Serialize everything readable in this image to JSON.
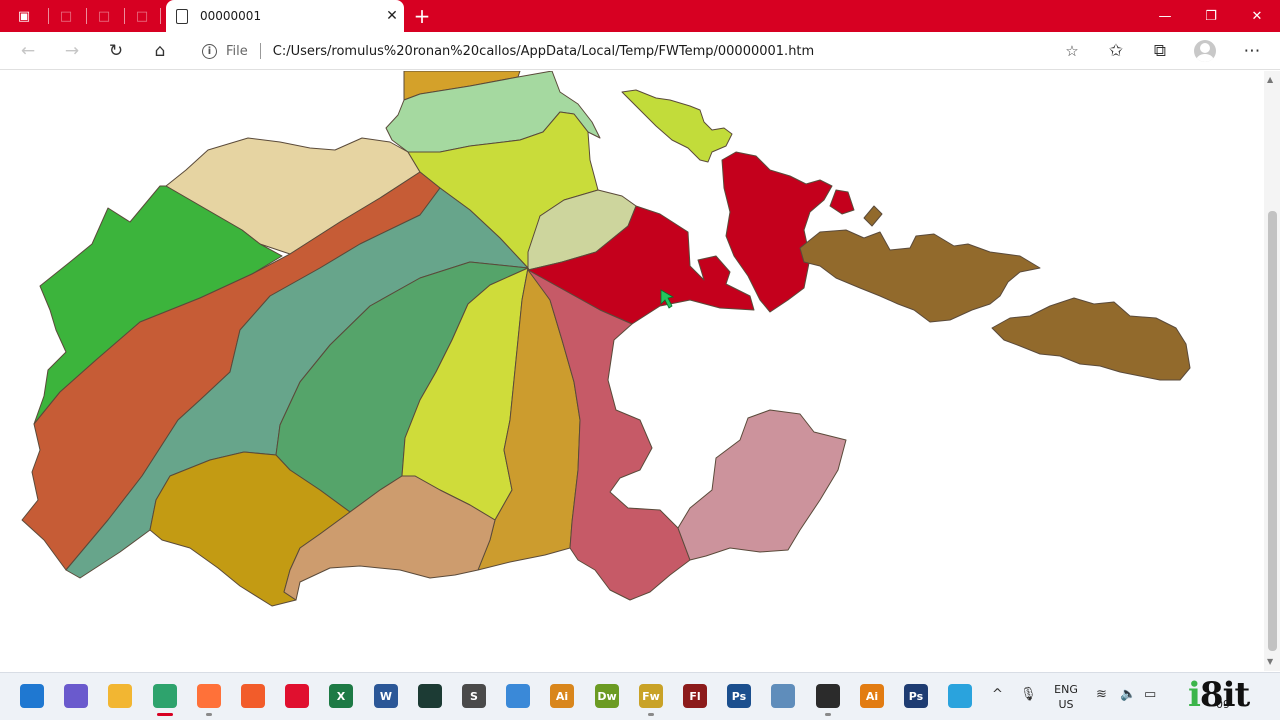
{
  "browser": {
    "tab_title": "00000001",
    "new_tab_symbol": "+",
    "close_symbol": "✕",
    "address": {
      "scheme_label": "File",
      "url": "C:/Users/romulus%20ronan%20callos/AppData/Local/Temp/FWTemp/00000001.htm"
    },
    "icons": {
      "tab_actions": "tab-actions-icon",
      "back": "back-arrow-icon",
      "forward": "forward-arrow-icon",
      "refresh": "refresh-icon",
      "home": "home-icon",
      "info": "info-icon",
      "add_favorite": "add-favorite-icon",
      "favorites": "favorites-icon",
      "collections": "collections-icon",
      "profile": "profile-icon",
      "more": "more-icon"
    },
    "accent": "#d70022"
  },
  "map": {
    "regions": [
      {
        "id": "top-orange-strip",
        "color": "#d4a12a"
      },
      {
        "id": "light-green-north",
        "color": "#a5d9a0"
      },
      {
        "id": "tan-northwest",
        "color": "#e6d4a2"
      },
      {
        "id": "yellow-green-north",
        "color": "#c9dc3a"
      },
      {
        "id": "pale-sage",
        "color": "#cdd59d"
      },
      {
        "id": "bright-green-west",
        "color": "#3cb43c"
      },
      {
        "id": "rust-diagonal",
        "color": "#c65c36"
      },
      {
        "id": "teal-diagonal",
        "color": "#67a58b"
      },
      {
        "id": "medium-green",
        "color": "#55a46a"
      },
      {
        "id": "yellow-green-south",
        "color": "#cfdc3a"
      },
      {
        "id": "orange-south",
        "color": "#cc9c2e"
      },
      {
        "id": "crimson-east",
        "color": "#c4001c"
      },
      {
        "id": "rose-southeast",
        "color": "#c65a67"
      },
      {
        "id": "pink-peninsula",
        "color": "#cc939c"
      },
      {
        "id": "olive-gold-southwest",
        "color": "#c39b13"
      },
      {
        "id": "sand-south",
        "color": "#cd9c6e"
      },
      {
        "id": "lime-island",
        "color": "#c2dc3a"
      },
      {
        "id": "brown-islands",
        "color": "#926a2c"
      }
    ]
  },
  "taskbar": {
    "apps": [
      {
        "icon": "start-icon",
        "label": "",
        "color": "#1f78d1"
      },
      {
        "icon": "app-store-icon",
        "label": "",
        "color": "#6a5acd"
      },
      {
        "icon": "file-explorer-icon",
        "label": "",
        "color": "#f2b632"
      },
      {
        "icon": "edge-icon",
        "label": "",
        "color": "#2ea36d"
      },
      {
        "icon": "firefox-icon",
        "label": "",
        "color": "#ff7139"
      },
      {
        "icon": "brave-icon",
        "label": "",
        "color": "#f25c2a"
      },
      {
        "icon": "opera-icon",
        "label": "",
        "color": "#e0102f"
      },
      {
        "icon": "excel-icon",
        "label": "X",
        "color": "#1d7a45"
      },
      {
        "icon": "word-icon",
        "label": "W",
        "color": "#2b5797"
      },
      {
        "icon": "media-icon",
        "label": "",
        "color": "#1c3b34"
      },
      {
        "icon": "sublime-icon",
        "label": "S",
        "color": "#4a4a4a"
      },
      {
        "icon": "notepad-icon",
        "label": "",
        "color": "#3a89d8"
      },
      {
        "icon": "illustrator-icon",
        "label": "Ai",
        "color": "#d9861c"
      },
      {
        "icon": "dreamweaver-icon",
        "label": "Dw",
        "color": "#6b9b23"
      },
      {
        "icon": "fireworks-icon",
        "label": "Fw",
        "color": "#c9a227"
      },
      {
        "icon": "flash-icon",
        "label": "Fl",
        "color": "#8c1b1b"
      },
      {
        "icon": "photoshop-icon",
        "label": "Ps",
        "color": "#1b4f8e"
      },
      {
        "icon": "image-viewer-icon",
        "label": "",
        "color": "#5f8dbb"
      },
      {
        "icon": "obs-icon",
        "label": "",
        "color": "#2b2b2b"
      },
      {
        "icon": "illustrator-2-icon",
        "label": "Ai",
        "color": "#e27c12"
      },
      {
        "icon": "photoshop-2-icon",
        "label": "Ps",
        "color": "#1e3c72"
      },
      {
        "icon": "telegram-icon",
        "label": "",
        "color": "#2aa3dd"
      }
    ],
    "tray": {
      "chevron_icon": "chevron-up-icon",
      "mic_icon": "microphone-icon",
      "lang_line1": "ENG",
      "lang_line2": "US",
      "wifi_icon": "wifi-icon",
      "volume_icon": "volume-icon",
      "battery_icon": "battery-icon",
      "clock_date": "09"
    },
    "brand": "i8it"
  }
}
